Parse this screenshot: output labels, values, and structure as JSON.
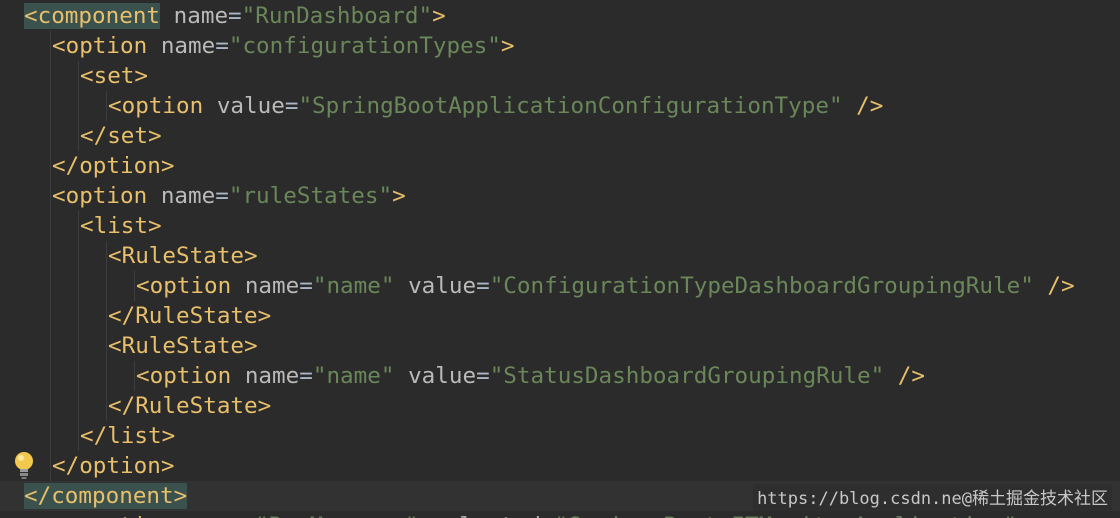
{
  "editor": {
    "lines": [
      {
        "indent": 0,
        "tokens": [
          {
            "t": "t match",
            "s": "<component"
          },
          {
            "t": "a",
            "s": " name"
          },
          {
            "t": "q",
            "s": "="
          },
          {
            "t": "v",
            "s": "\"RunDashboard\""
          },
          {
            "t": "t",
            "s": ">"
          }
        ]
      },
      {
        "indent": 1,
        "tokens": [
          {
            "t": "t",
            "s": "<option"
          },
          {
            "t": "a",
            "s": " name"
          },
          {
            "t": "q",
            "s": "="
          },
          {
            "t": "v",
            "s": "\"configurationTypes\""
          },
          {
            "t": "t",
            "s": ">"
          }
        ]
      },
      {
        "indent": 2,
        "tokens": [
          {
            "t": "t",
            "s": "<set>"
          }
        ]
      },
      {
        "indent": 3,
        "tokens": [
          {
            "t": "t",
            "s": "<option"
          },
          {
            "t": "a",
            "s": " value"
          },
          {
            "t": "q",
            "s": "="
          },
          {
            "t": "v",
            "s": "\"SpringBootApplicationConfigurationType\""
          },
          {
            "t": "t",
            "s": " />"
          }
        ]
      },
      {
        "indent": 2,
        "tokens": [
          {
            "t": "t",
            "s": "</set>"
          }
        ]
      },
      {
        "indent": 1,
        "tokens": [
          {
            "t": "t",
            "s": "</option>"
          }
        ]
      },
      {
        "indent": 1,
        "tokens": [
          {
            "t": "t",
            "s": "<option"
          },
          {
            "t": "a",
            "s": " name"
          },
          {
            "t": "q",
            "s": "="
          },
          {
            "t": "v",
            "s": "\"ruleStates\""
          },
          {
            "t": "t",
            "s": ">"
          }
        ]
      },
      {
        "indent": 2,
        "tokens": [
          {
            "t": "t",
            "s": "<list>"
          }
        ]
      },
      {
        "indent": 3,
        "tokens": [
          {
            "t": "t",
            "s": "<RuleState>"
          }
        ]
      },
      {
        "indent": 4,
        "tokens": [
          {
            "t": "t",
            "s": "<option"
          },
          {
            "t": "a",
            "s": " name"
          },
          {
            "t": "q",
            "s": "="
          },
          {
            "t": "v",
            "s": "\"name\""
          },
          {
            "t": "a",
            "s": " value"
          },
          {
            "t": "q",
            "s": "="
          },
          {
            "t": "v",
            "s": "\"ConfigurationTypeDashboardGroupingRule\""
          },
          {
            "t": "t",
            "s": " />"
          }
        ]
      },
      {
        "indent": 3,
        "tokens": [
          {
            "t": "t",
            "s": "</RuleState>"
          }
        ]
      },
      {
        "indent": 3,
        "tokens": [
          {
            "t": "t",
            "s": "<RuleState>"
          }
        ]
      },
      {
        "indent": 4,
        "tokens": [
          {
            "t": "t",
            "s": "<option"
          },
          {
            "t": "a",
            "s": " name"
          },
          {
            "t": "q",
            "s": "="
          },
          {
            "t": "v",
            "s": "\"name\""
          },
          {
            "t": "a",
            "s": " value"
          },
          {
            "t": "q",
            "s": "="
          },
          {
            "t": "v",
            "s": "\"StatusDashboardGroupingRule\""
          },
          {
            "t": "t",
            "s": " />"
          }
        ]
      },
      {
        "indent": 3,
        "tokens": [
          {
            "t": "t",
            "s": "</RuleState>"
          }
        ]
      },
      {
        "indent": 2,
        "tokens": [
          {
            "t": "t",
            "s": "</list>"
          }
        ]
      },
      {
        "indent": 1,
        "tokens": [
          {
            "t": "t",
            "s": "</option>"
          }
        ]
      },
      {
        "indent": 0,
        "current": true,
        "tokens": [
          {
            "t": "t match",
            "s": "</component>"
          }
        ]
      },
      {
        "indent": 0,
        "partial": true,
        "tokens": [
          {
            "t": "t",
            "s": "    <option"
          },
          {
            "t": "a",
            "s": " name"
          },
          {
            "t": "q",
            "s": "="
          },
          {
            "t": "v",
            "s": "\"RunManager\""
          },
          {
            "t": "a",
            "s": " selected"
          },
          {
            "t": "q",
            "s": "="
          },
          {
            "t": "v",
            "s": "\"Spring Boot.ITMonitorApplication\""
          }
        ]
      }
    ]
  },
  "watermark": "https://blog.csdn.ne@稀土掘金技术社区",
  "icons": {
    "intention": "lightbulb-icon"
  },
  "colors": {
    "background": "#2b2b2b",
    "tag": "#e8bf6a",
    "attribute": "#bababa",
    "value": "#6a8759",
    "bracket_match": "#3b514d"
  }
}
